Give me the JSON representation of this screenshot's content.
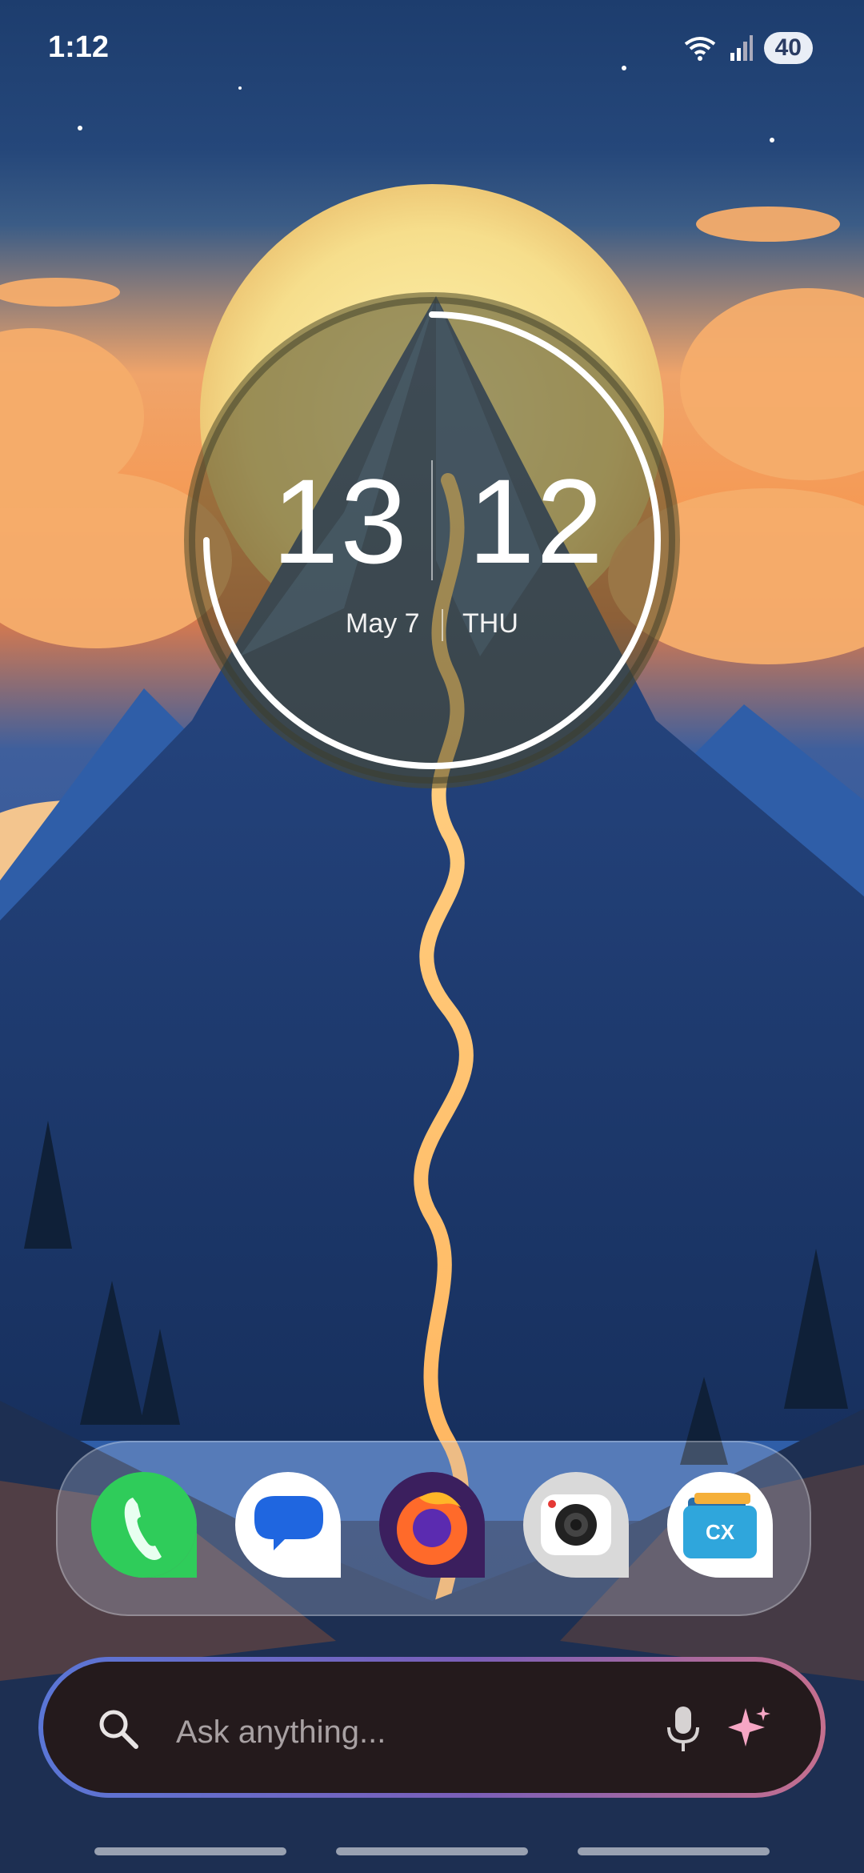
{
  "status_bar": {
    "time": "1:12",
    "battery": "40"
  },
  "clock_widget": {
    "hour": "13",
    "minute": "12",
    "date": "May 7",
    "weekday": "THU"
  },
  "dock": {
    "apps": [
      {
        "name": "Phone",
        "icon": "phone-icon"
      },
      {
        "name": "Messages",
        "icon": "messages-icon"
      },
      {
        "name": "Firefox",
        "icon": "firefox-icon"
      },
      {
        "name": "Camera",
        "icon": "camera-icon"
      },
      {
        "name": "File Manager",
        "icon": "folder-icon"
      }
    ],
    "file_manager_badge": "CX"
  },
  "search_bar": {
    "placeholder": "Ask anything..."
  },
  "colors": {
    "accent_blue": "#5a76d6",
    "accent_pink": "#c56f8e",
    "search_bg": "#241a1c"
  }
}
